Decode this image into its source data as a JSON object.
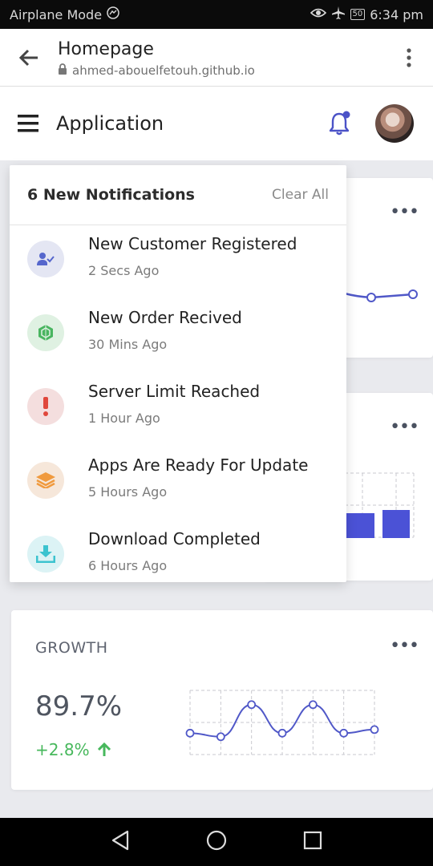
{
  "status_bar": {
    "left_text": "Airplane Mode",
    "battery": "50",
    "time": "6:34 pm"
  },
  "browser": {
    "page_title": "Homepage",
    "url": "ahmed-abouelfetouh.github.io"
  },
  "app_header": {
    "title": "Application"
  },
  "notifications": {
    "header": "6 New Notifications",
    "clear_label": "Clear All",
    "items": [
      {
        "title": "New Customer Registered",
        "time": "2 Secs Ago",
        "icon": "user-check-icon",
        "color": "#5566cc",
        "bg": "#e4e6f3"
      },
      {
        "title": "New Order Recived",
        "time": "30 Mins Ago",
        "icon": "cart-icon",
        "color": "#49b560",
        "bg": "#dff1e2"
      },
      {
        "title": "Server Limit Reached",
        "time": "1 Hour Ago",
        "icon": "exclamation-icon",
        "color": "#e0473c",
        "bg": "#f4dede"
      },
      {
        "title": "Apps Are Ready For Update",
        "time": "5 Hours Ago",
        "icon": "layers-icon",
        "color": "#f09a3e",
        "bg": "#f6e7da"
      },
      {
        "title": "Download Completed",
        "time": "6 Hours Ago",
        "icon": "download-icon",
        "color": "#3cc3cf",
        "bg": "#dcf3f5"
      }
    ]
  },
  "growth": {
    "label": "GROWTH",
    "value": "89.7%",
    "change": "+2.8%"
  },
  "colors": {
    "accent": "#5058c8",
    "positive": "#47b85c"
  },
  "chart_data": {
    "type": "line",
    "values": [
      6,
      5,
      14,
      6,
      14,
      6,
      7
    ],
    "ylim": [
      0,
      18
    ],
    "grid": true
  }
}
